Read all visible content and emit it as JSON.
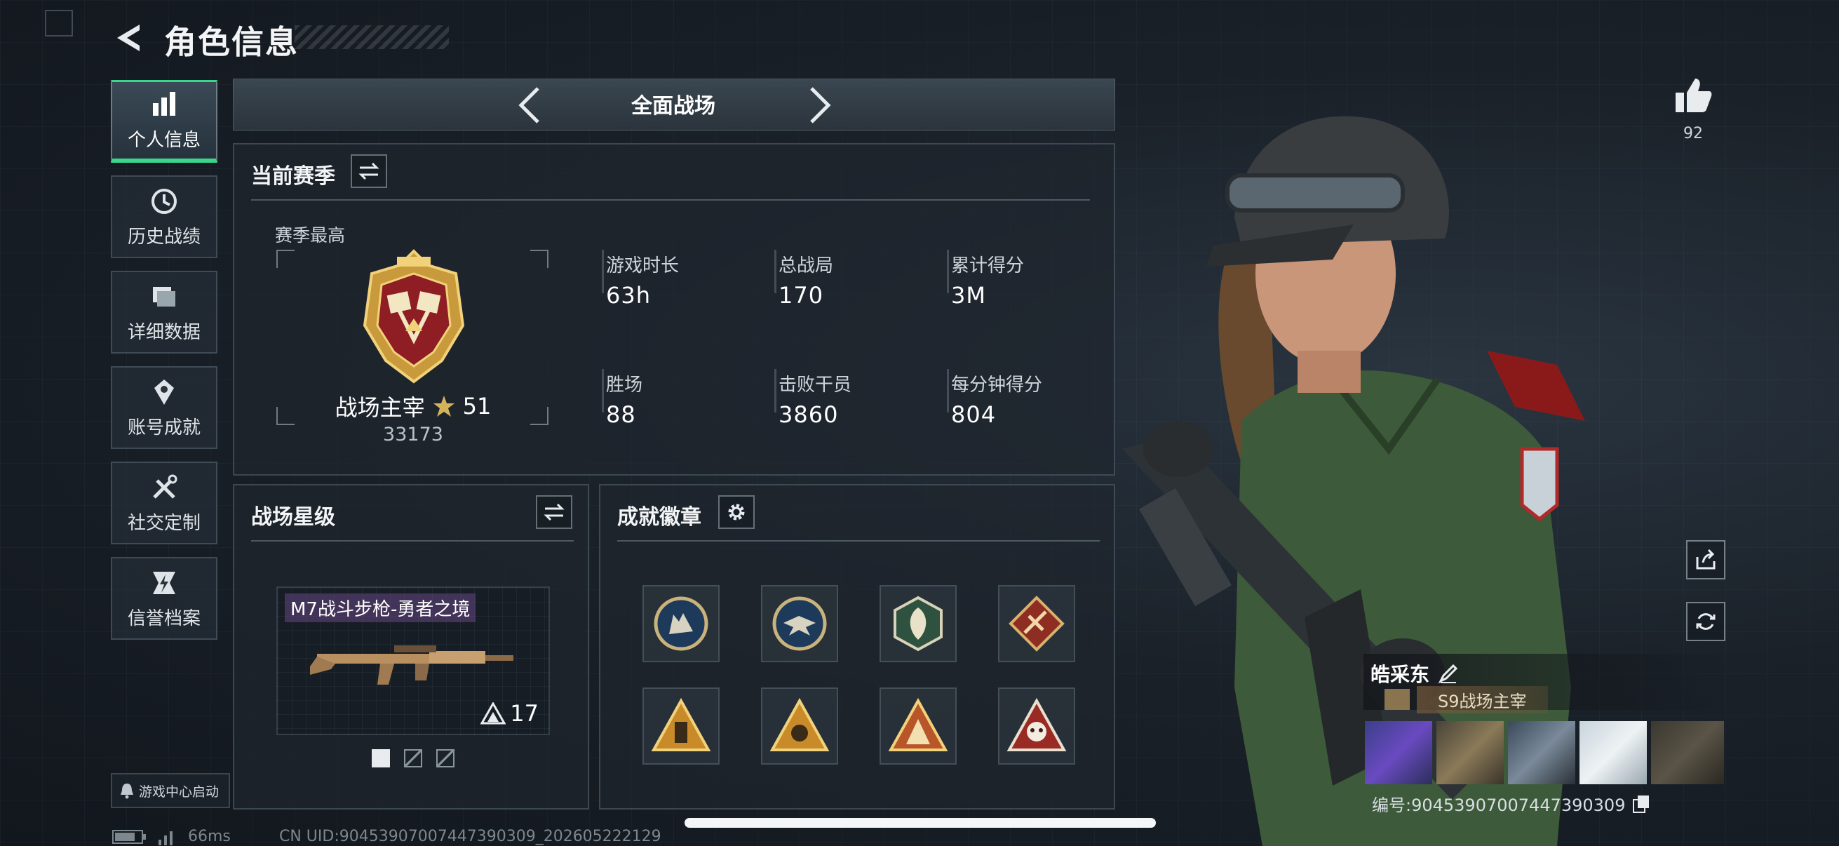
{
  "header": {
    "title": "角色信息"
  },
  "nav": {
    "items": [
      {
        "label": "个人信息",
        "icon": "bar-chart-icon",
        "active": true
      },
      {
        "label": "历史战绩",
        "icon": "history-icon",
        "active": false
      },
      {
        "label": "详细数据",
        "icon": "folder-icon",
        "active": false
      },
      {
        "label": "账号成就",
        "icon": "achievement-icon",
        "active": false
      },
      {
        "label": "社交定制",
        "icon": "tools-icon",
        "active": false
      },
      {
        "label": "信誉档案",
        "icon": "credit-icon",
        "active": false
      }
    ],
    "game_center_label": "游戏中心启动"
  },
  "mode": {
    "title": "全面战场"
  },
  "season": {
    "title": "当前赛季",
    "best_label": "赛季最高",
    "rank_name": "战场主宰",
    "rank_stars": "51",
    "rank_score": "33173",
    "stats": [
      {
        "label": "游戏时长",
        "value": "63h"
      },
      {
        "label": "总战局",
        "value": "170"
      },
      {
        "label": "累计得分",
        "value": "3M"
      },
      {
        "label": "胜场",
        "value": "88"
      },
      {
        "label": "击败干员",
        "value": "3860"
      },
      {
        "label": "每分钟得分",
        "value": "804"
      }
    ]
  },
  "star_level": {
    "title": "战场星级",
    "weapon_name": "M7战斗步枪-勇者之境",
    "weapon_level": "17",
    "page_count": 3,
    "current_page": 1
  },
  "badges": {
    "title": "成就徽章",
    "items": [
      {
        "icon": "wolf-badge-icon",
        "shape": "circle",
        "color": "#c9b37a"
      },
      {
        "icon": "eagle-badge-icon",
        "shape": "circle",
        "color": "#c9b37a"
      },
      {
        "icon": "leaf-badge-icon",
        "shape": "hexagon",
        "color": "#d8d2b8"
      },
      {
        "icon": "weapon-badge-icon",
        "shape": "diamond",
        "color": "#b44a38"
      },
      {
        "icon": "tower-badge-icon",
        "shape": "triangle",
        "color": "#d59a3a"
      },
      {
        "icon": "crest-badge-icon",
        "shape": "triangle",
        "color": "#d59a3a"
      },
      {
        "icon": "fort-badge-icon",
        "shape": "triangle",
        "color": "#c85a3a"
      },
      {
        "icon": "skull-badge-icon",
        "shape": "triangle",
        "color": "#a83a30"
      }
    ]
  },
  "profile": {
    "likes": "92",
    "player_name": "皓采东",
    "title_badge": "S9战场主宰",
    "player_id_text": "编号:90453907007447390309"
  },
  "status": {
    "ping": "66ms",
    "uid_text": "CN UID:90453907007447390309_202605222129"
  },
  "colors": {
    "accent": "#3ad68c",
    "background": "#1a2129",
    "gold": "#d4a84a",
    "rank_red": "#8e1e24"
  }
}
